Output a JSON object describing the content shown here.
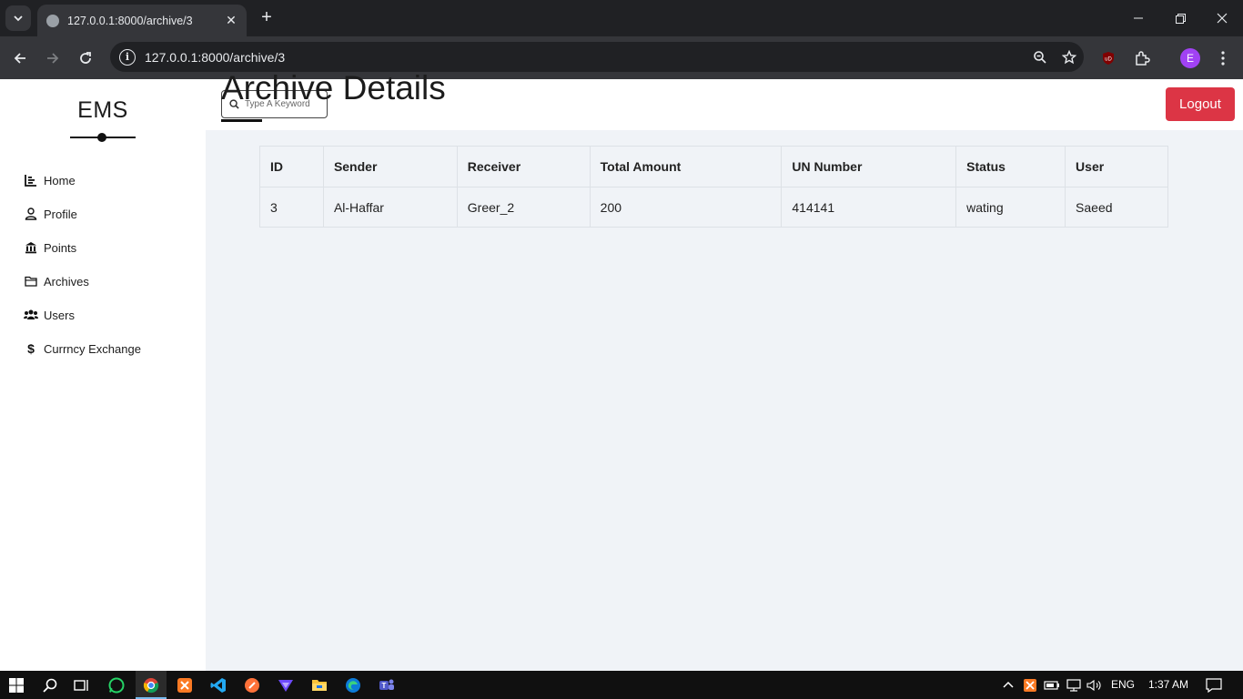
{
  "browser": {
    "tab_title": "127.0.0.1:8000/archive/3",
    "url": "127.0.0.1:8000/archive/3",
    "profile_initial": "E"
  },
  "app": {
    "brand": "EMS",
    "sidebar": {
      "items": [
        {
          "label": "Home",
          "icon": "chart-icon"
        },
        {
          "label": "Profile",
          "icon": "user-icon"
        },
        {
          "label": "Points",
          "icon": "bank-icon"
        },
        {
          "label": "Archives",
          "icon": "folder-icon"
        },
        {
          "label": "Users",
          "icon": "users-icon"
        },
        {
          "label": "Currncy Exchange",
          "icon": "dollar-icon"
        }
      ]
    },
    "search": {
      "placeholder": "Type A Keyword"
    },
    "logout_label": "Logout",
    "page_title": "Archive Details",
    "table": {
      "headers": [
        "ID",
        "Sender",
        "Receiver",
        "Total Amount",
        "UN Number",
        "Status",
        "User"
      ],
      "rows": [
        [
          "3",
          "Al-Haffar",
          "Greer_2",
          "200",
          "414141",
          "wating",
          "Saeed"
        ]
      ]
    },
    "colors": {
      "logout": "#dc3545",
      "background": "#f0f3f7"
    }
  },
  "taskbar": {
    "language": "ENG",
    "time": "1:37 AM"
  }
}
